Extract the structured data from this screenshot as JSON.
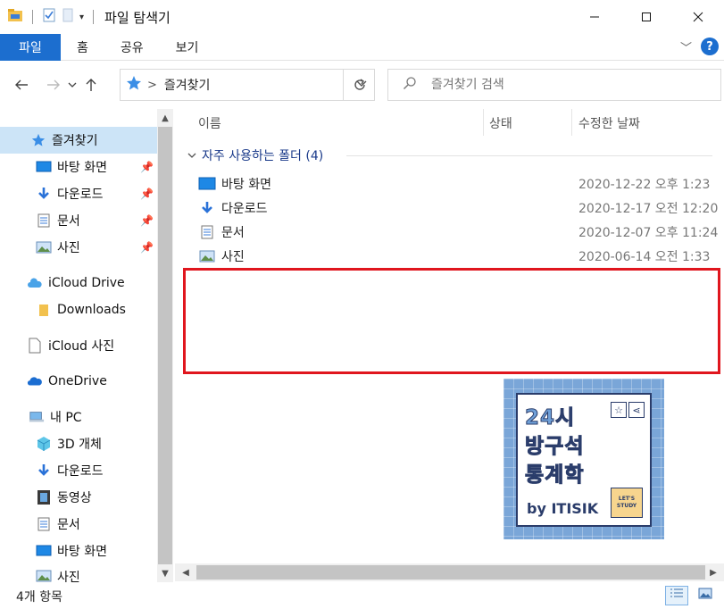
{
  "window": {
    "title": "파일 탐색기"
  },
  "ribbon": {
    "tabs": [
      "파일",
      "홈",
      "공유",
      "보기"
    ]
  },
  "address": {
    "location": "즐겨찾기"
  },
  "search": {
    "placeholder": "즐겨찾기 검색"
  },
  "sidebar": {
    "items": [
      {
        "label": "즐겨찾기",
        "icon": "star-icon",
        "selected": true
      },
      {
        "label": "바탕 화면",
        "icon": "desktop-icon",
        "pinned": true
      },
      {
        "label": "다운로드",
        "icon": "download-icon",
        "pinned": true
      },
      {
        "label": "문서",
        "icon": "document-icon",
        "pinned": true
      },
      {
        "label": "사진",
        "icon": "picture-icon",
        "pinned": true
      },
      {
        "label": "iCloud Drive",
        "icon": "cloud-icon"
      },
      {
        "label": "Downloads",
        "icon": "folder-icon"
      },
      {
        "label": "iCloud 사진",
        "icon": "page-icon"
      },
      {
        "label": "OneDrive",
        "icon": "onedrive-icon"
      },
      {
        "label": "내 PC",
        "icon": "pc-icon"
      },
      {
        "label": "3D 개체",
        "icon": "cube-icon"
      },
      {
        "label": "다운로드",
        "icon": "download-icon"
      },
      {
        "label": "동영상",
        "icon": "video-icon"
      },
      {
        "label": "문서",
        "icon": "document-icon"
      },
      {
        "label": "바탕 화면",
        "icon": "desktop-icon"
      },
      {
        "label": "사진",
        "icon": "picture-icon"
      }
    ]
  },
  "columns": [
    "이름",
    "상태",
    "수정한 날짜"
  ],
  "group": {
    "label": "자주 사용하는 폴더 (4)"
  },
  "files": [
    {
      "name": "바탕 화면",
      "icon": "desktop-icon",
      "date": "2020-12-22 오후 1:23"
    },
    {
      "name": "다운로드",
      "icon": "download-icon",
      "date": "2020-12-17 오전 12:20"
    },
    {
      "name": "문서",
      "icon": "document-icon",
      "date": "2020-12-07 오후 11:24"
    },
    {
      "name": "사진",
      "icon": "picture-icon",
      "date": "2020-06-14 오전 1:33"
    }
  ],
  "logo": {
    "line1": "24시",
    "line2": "방구석",
    "line3": "통계학",
    "by": "by ITISIK",
    "sticker": "LET'S STUDY"
  },
  "status": {
    "count": "4개 항목"
  },
  "colors": {
    "accent": "#1c6ecf",
    "highlight": "#e0161e",
    "selected": "#cce4f7"
  }
}
